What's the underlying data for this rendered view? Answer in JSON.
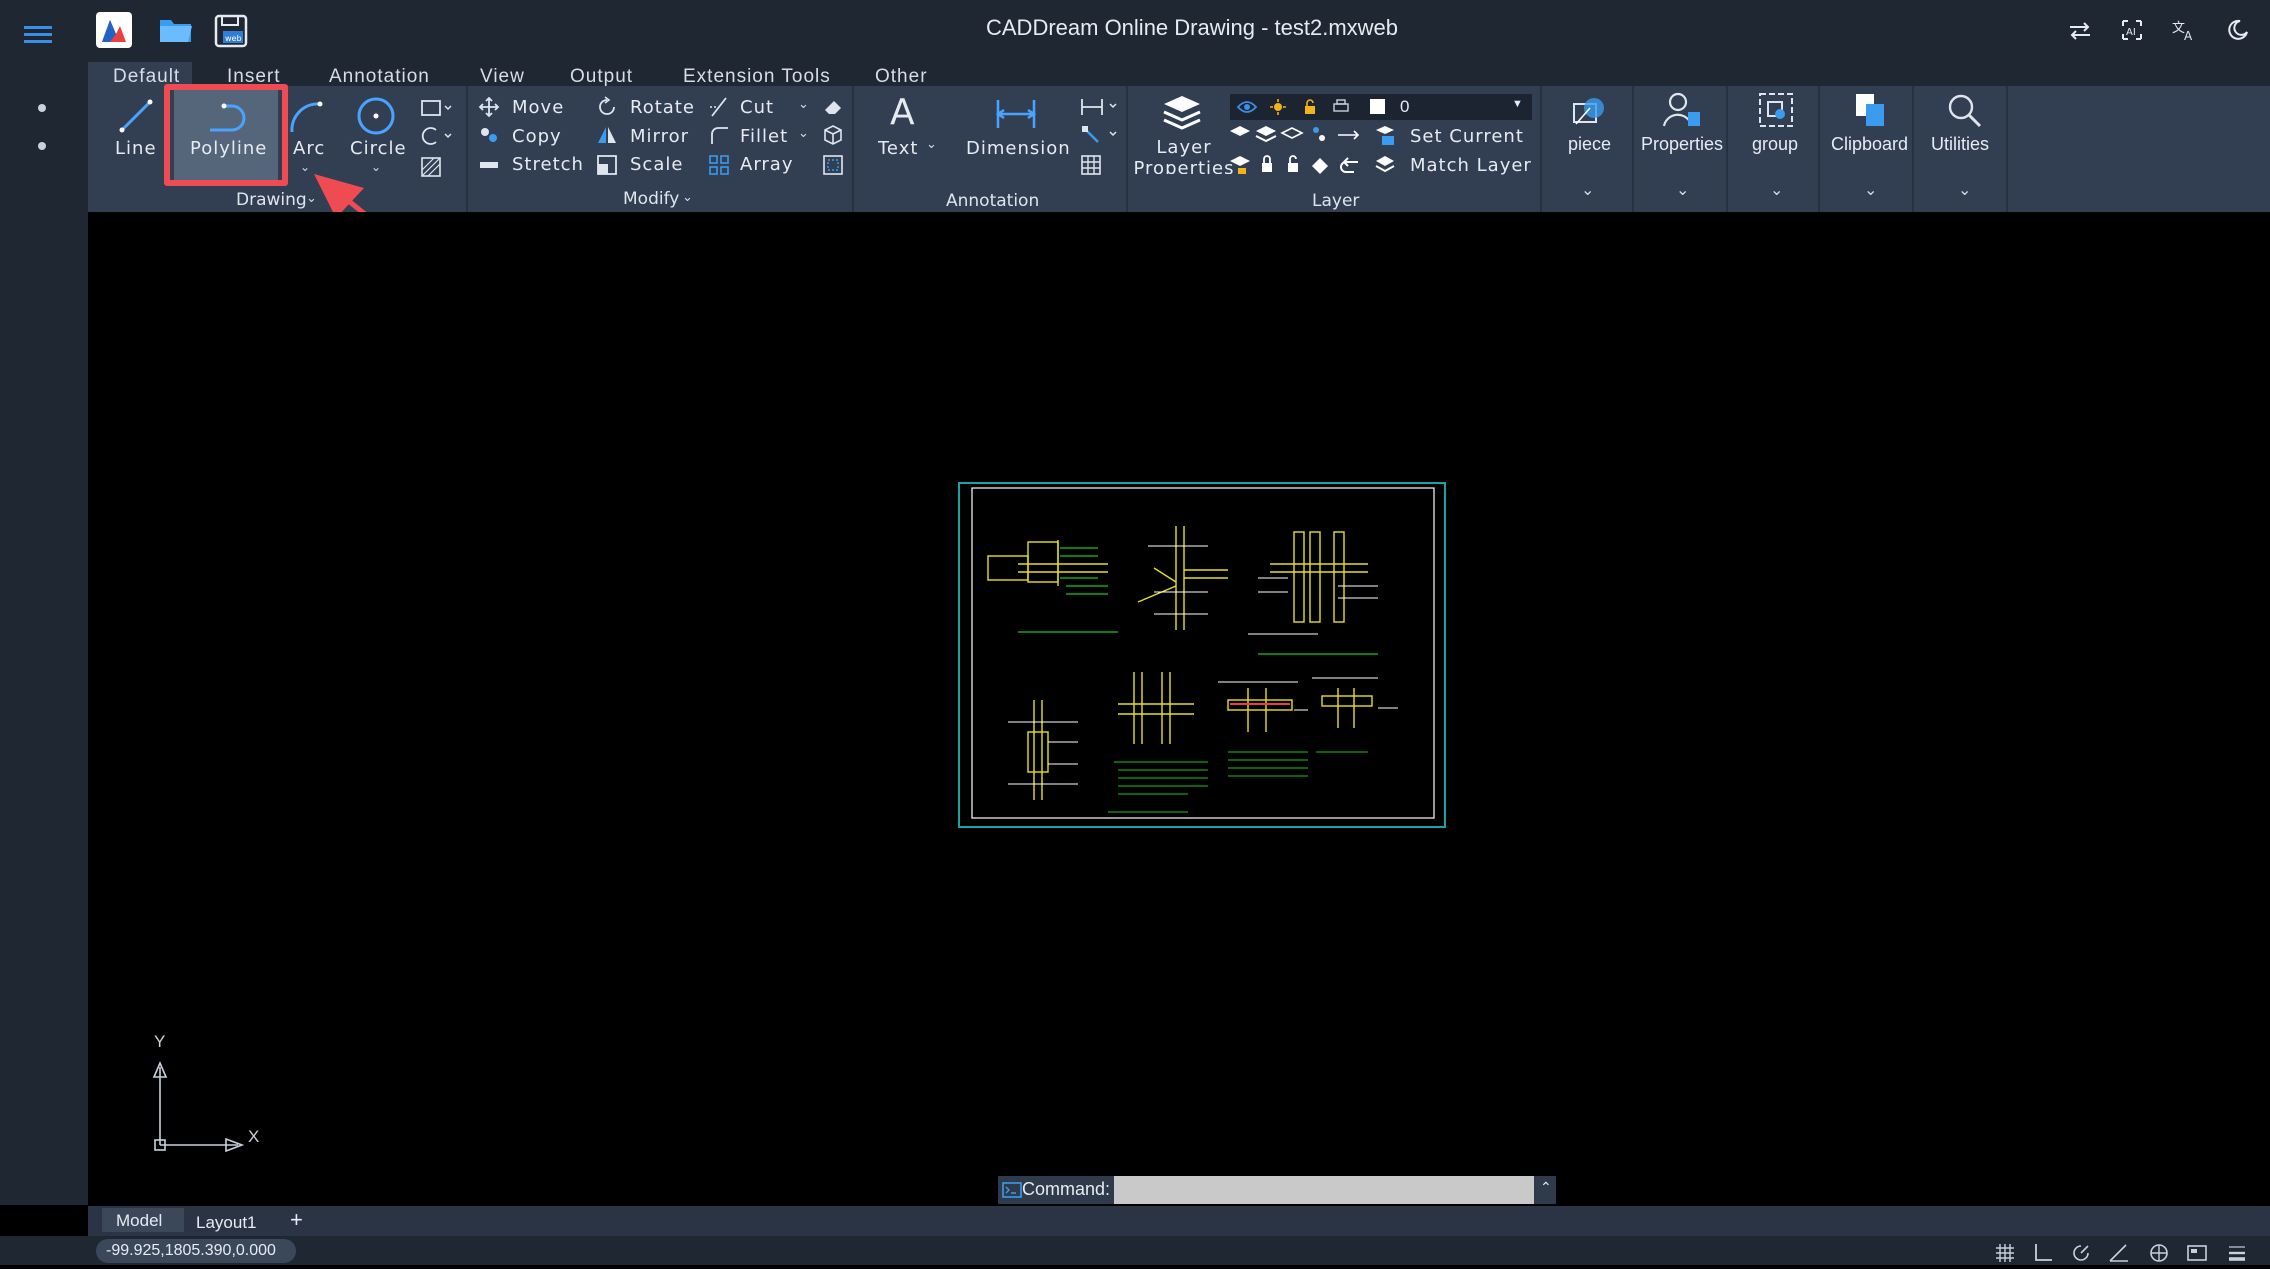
{
  "window": {
    "title": "CADDream Online Drawing - test2.mxweb"
  },
  "ribbon_tabs": [
    "Default",
    "Insert",
    "Annotation",
    "View",
    "Output",
    "Extension Tools",
    "Other"
  ],
  "drawing": {
    "line": "Line",
    "polyline": "Polyline",
    "arc": "Arc",
    "circle": "Circle",
    "group": "Drawing"
  },
  "modify": {
    "move": "Move",
    "copy": "Copy",
    "stretch": "Stretch",
    "rotate": "Rotate",
    "mirror": "Mirror",
    "scale": "Scale",
    "cut": "Cut",
    "fillet": "Fillet",
    "array": "Array",
    "group": "Modify"
  },
  "annotation": {
    "text": "Text",
    "dimension": "Dimension",
    "group": "Annotation"
  },
  "layer": {
    "properties": "Layer Properties",
    "current_layer": "0",
    "set_current": "Set Current",
    "match_layer": "Match Layer",
    "group": "Layer"
  },
  "panels": {
    "piece": "piece",
    "properties": "Properties",
    "group": "group",
    "clipboard": "Clipboard",
    "utilities": "Utilities"
  },
  "axes": {
    "y": "Y",
    "x": "X"
  },
  "command": {
    "label": "Command:",
    "value": ""
  },
  "layout_tabs": [
    "Model",
    "Layout1"
  ],
  "layout_add": "+",
  "coords": "-99.925,1805.390,0.000",
  "colors": {
    "titlebar": "#1f2733",
    "ribbon": "#323f52",
    "accent_red": "#ee4b52",
    "drawing_green": "#19c41d",
    "drawing_yellow": "#e6e21a",
    "highlight": "#55657a"
  }
}
